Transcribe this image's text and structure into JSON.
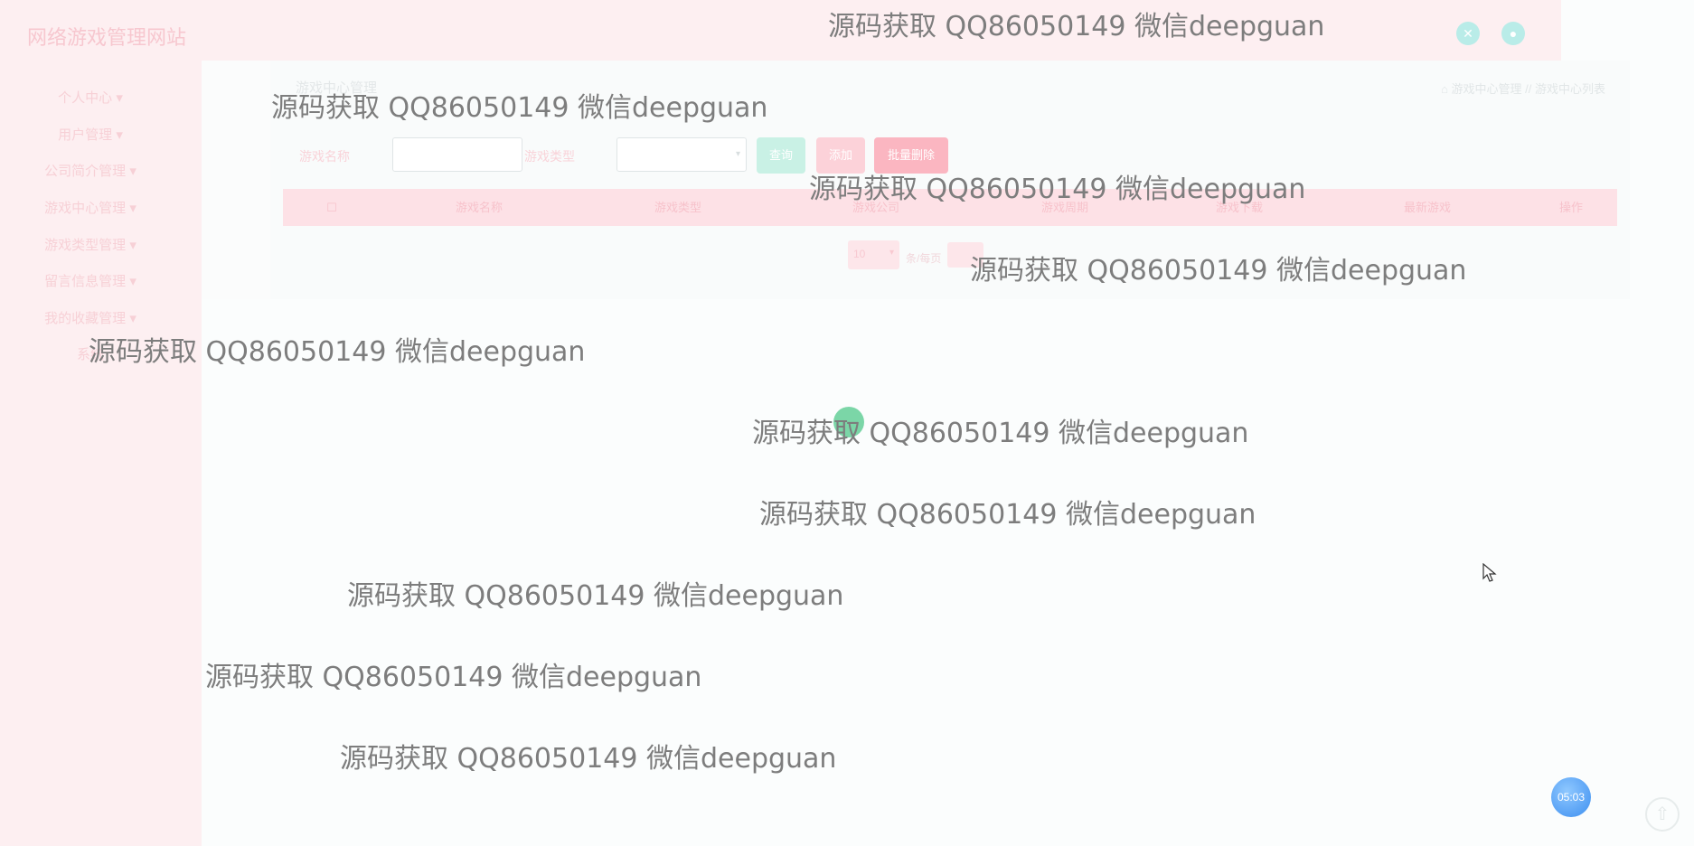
{
  "app": {
    "title": "网络游戏管理网站"
  },
  "top_icons": [
    "expand-icon",
    "user-icon"
  ],
  "sidebar": {
    "items": [
      {
        "label": "个人中心"
      },
      {
        "label": "用户管理"
      },
      {
        "label": "公司简介管理"
      },
      {
        "label": "游戏中心管理"
      },
      {
        "label": "游戏类型管理"
      },
      {
        "label": "留言信息管理"
      },
      {
        "label": "我的收藏管理"
      },
      {
        "label": "系统"
      }
    ]
  },
  "page": {
    "heading": "游戏中心管理",
    "breadcrumb": "游戏中心管理 // 游戏中心列表"
  },
  "search": {
    "name_label": "游戏名称",
    "type_label": "游戏类型",
    "query_button": "查询",
    "add_button": "添加",
    "batch_delete_button": "批量删除"
  },
  "table": {
    "headers": [
      "",
      "游戏名称",
      "游戏类型",
      "游戏公司",
      "游戏周期",
      "游戏下载",
      "最新游戏",
      "操作"
    ]
  },
  "pager": {
    "page_size": "10",
    "per_page_text": "条/每页"
  },
  "watermarks": [
    "源码获取 QQ86050149 微信deepguan",
    "源码获取 QQ86050149 微信deepguan",
    "源码获取 QQ86050149 微信deepguan",
    "源码获取 QQ86050149 微信deepguan",
    "源码获取 QQ86050149 微信deepguan",
    "源码获取 QQ86050149 微信deepguan",
    "源码获取 QQ86050149 微信deepguan",
    "源码获取 QQ86050149 微信deepguan",
    "源码获取 QQ86050149 微信deepguan",
    "源码获取 QQ86050149 微信deepguan"
  ],
  "timer": "05:03",
  "colors": {
    "theme_pink": "#fdeff1",
    "accent_teal": "#b9ece8",
    "query_button": "#c9f1e5",
    "add_button": "#fcd2d9",
    "delete_button": "#fbb6c1"
  }
}
